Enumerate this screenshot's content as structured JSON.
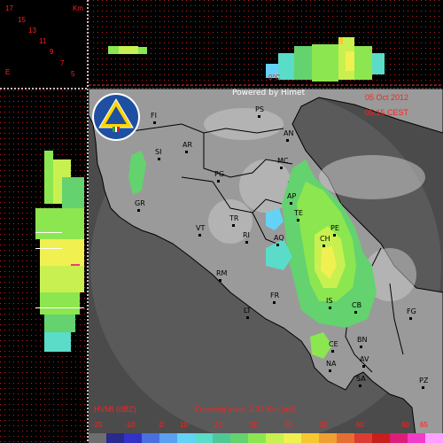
{
  "header": {
    "powered_by": "Powered by Himet",
    "date": "05 Oct 2012",
    "time": "05:15 CEST"
  },
  "freezing_level_marker": "0°C",
  "left_scale": {
    "unit": "Km",
    "ticks": [
      "17",
      "15",
      "13",
      "11",
      "9",
      "7",
      "5",
      "E"
    ]
  },
  "footer": {
    "product": "HVMI (dBZ)",
    "freezing_level": "Freezing level: 2.37 Km (asl)"
  },
  "colorbar": {
    "ticks": [
      "-20",
      "-10",
      "0",
      "10",
      "20",
      "30",
      "40",
      "50",
      "60",
      "60",
      "65"
    ],
    "colors": [
      "#6e6e6e",
      "#2a2a8a",
      "#3232c8",
      "#4a70e0",
      "#5aa0f0",
      "#64d2f5",
      "#5adcc8",
      "#4ec896",
      "#64d26e",
      "#8ce650",
      "#c8f050",
      "#f0f050",
      "#f5c832",
      "#f0a032",
      "#e66e32",
      "#dc3c32",
      "#c81e1e",
      "#dc1e78",
      "#f03cc8",
      "#ffa0ff"
    ]
  },
  "cities": [
    {
      "code": "PS"
    },
    {
      "code": "FI"
    },
    {
      "code": "AN"
    },
    {
      "code": "SI"
    },
    {
      "code": "AR"
    },
    {
      "code": "MC"
    },
    {
      "code": "PG"
    },
    {
      "code": "AP"
    },
    {
      "code": "GR"
    },
    {
      "code": "TE"
    },
    {
      "code": "TR"
    },
    {
      "code": "VT"
    },
    {
      "code": "RI"
    },
    {
      "code": "PE"
    },
    {
      "code": "AQ"
    },
    {
      "code": "CH"
    },
    {
      "code": "RM"
    },
    {
      "code": "FR"
    },
    {
      "code": "IS"
    },
    {
      "code": "CB"
    },
    {
      "code": "FG"
    },
    {
      "code": "LT"
    },
    {
      "code": "BN"
    },
    {
      "code": "CE"
    },
    {
      "code": "AV"
    },
    {
      "code": "NA"
    },
    {
      "code": "SA"
    },
    {
      "code": "PZ"
    }
  ],
  "colors": {
    "background": "#000000",
    "sea": "#4b4b4b",
    "coverage_disc": "#5a5a5a",
    "land": "#9a9a9a",
    "text_red": "#ff2020",
    "grid_red": "#c81e1e",
    "logo_blue": "#1f4fa0"
  }
}
